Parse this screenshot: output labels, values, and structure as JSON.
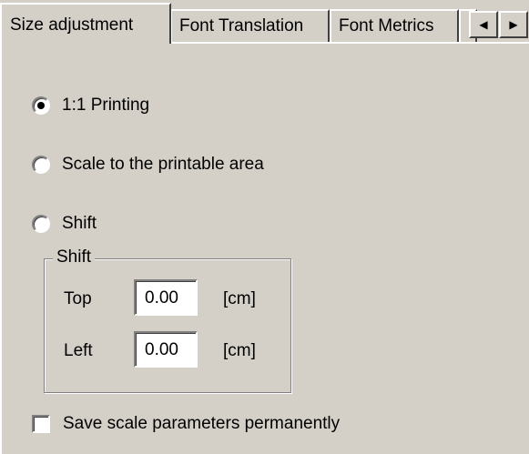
{
  "tabs": [
    {
      "label": "Size adjustment",
      "active": true
    },
    {
      "label": "Font Translation",
      "active": false
    },
    {
      "label": "Font Metrics",
      "active": false
    }
  ],
  "tab_scroll": {
    "left_icon": "◀",
    "right_icon": "▶"
  },
  "scale_mode": {
    "selected": "1:1 Printing",
    "options": [
      {
        "label": "1:1 Printing",
        "checked": true
      },
      {
        "label": "Scale to the printable area",
        "checked": false
      },
      {
        "label": "Shift",
        "checked": false
      }
    ]
  },
  "shift_group": {
    "title": "Shift",
    "top_label": "Top",
    "top_value": "0.00",
    "top_unit": "[cm]",
    "left_label": "Left",
    "left_value": "0.00",
    "left_unit": "[cm]"
  },
  "save_permanently": {
    "label": "Save scale parameters permanently",
    "checked": false
  }
}
